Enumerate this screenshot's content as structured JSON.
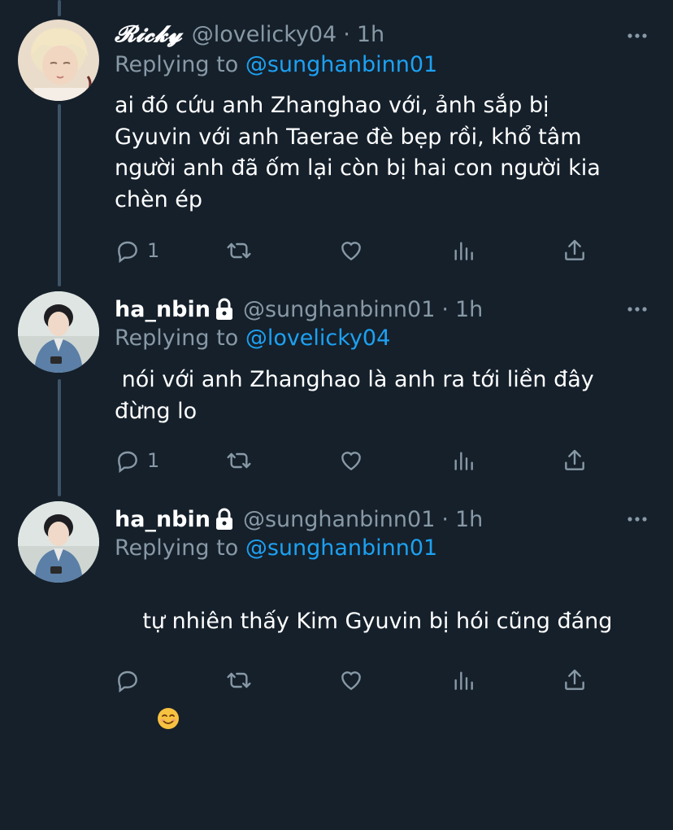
{
  "tweets": [
    {
      "display_name": "𝓡𝓲𝓬𝓴𝔂",
      "handle": "@lovelicky04",
      "separator": "·",
      "time": "1h",
      "replying_prefix": "Replying to",
      "replying_to": "@sunghanbinn01",
      "text": "ai đó cứu anh Zhanghao với, ảnh sắp bị\nGyuvin với anh Taerae đè bẹp rồi, khổ tâm\nngười anh đã ốm lại còn bị hai con người kia\nchèn ép",
      "reply_count": "1",
      "locked": false,
      "avatar_icon": "avatar-blonde"
    },
    {
      "display_name": "ha_nbin",
      "handle": "@sunghanbinn01",
      "separator": "·",
      "time": "1h",
      "replying_prefix": "Replying to",
      "replying_to": "@lovelicky04",
      "text": " nói với anh Zhanghao là anh ra tới liền đây\nđừng lo",
      "reply_count": "1",
      "locked": true,
      "avatar_icon": "avatar-denim"
    },
    {
      "display_name": "ha_nbin",
      "handle": "@sunghanbinn01",
      "separator": "·",
      "time": "1h",
      "replying_prefix": "Replying to",
      "replying_to": "@sunghanbinn01",
      "text": "tự nhiên thấy Kim Gyuvin bị hói cũng đáng",
      "emoji": "smiling-face-emoji",
      "reply_count": "",
      "locked": true,
      "avatar_icon": "avatar-denim"
    }
  ],
  "icons": {
    "reply": "reply-icon",
    "retweet": "retweet-icon",
    "like": "heart-icon",
    "analytics": "analytics-icon",
    "share": "share-icon",
    "more": "more-dots-icon",
    "lock": "lock-icon"
  },
  "colors": {
    "background": "#15202b",
    "text": "#ffffff",
    "secondary": "#8899a6",
    "accent": "#1da1f2",
    "thread_line": "#3d5466"
  }
}
